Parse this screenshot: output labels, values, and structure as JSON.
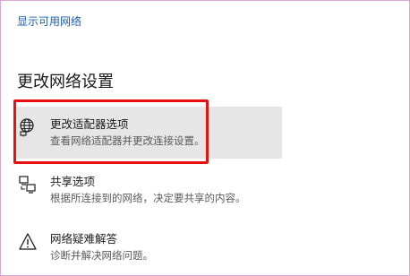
{
  "top_link": "显示可用网络",
  "section_title": "更改网络设置",
  "items": [
    {
      "title": "更改适配器选项",
      "desc": "查看网络适配器并更改连接设置。",
      "icon": "globe-monitor-icon"
    },
    {
      "title": "共享选项",
      "desc": "根据所连接到的网络，决定要共享的内容。",
      "icon": "sharing-computers-icon"
    },
    {
      "title": "网络疑难解答",
      "desc": "诊断并解决网络问题。",
      "icon": "warning-triangle-icon"
    }
  ],
  "colors": {
    "link": "#1a5fb4",
    "highlight_border": "#e8100f",
    "selected_bg": "#e6e6e6",
    "frame_border": "#d9a6d6"
  }
}
